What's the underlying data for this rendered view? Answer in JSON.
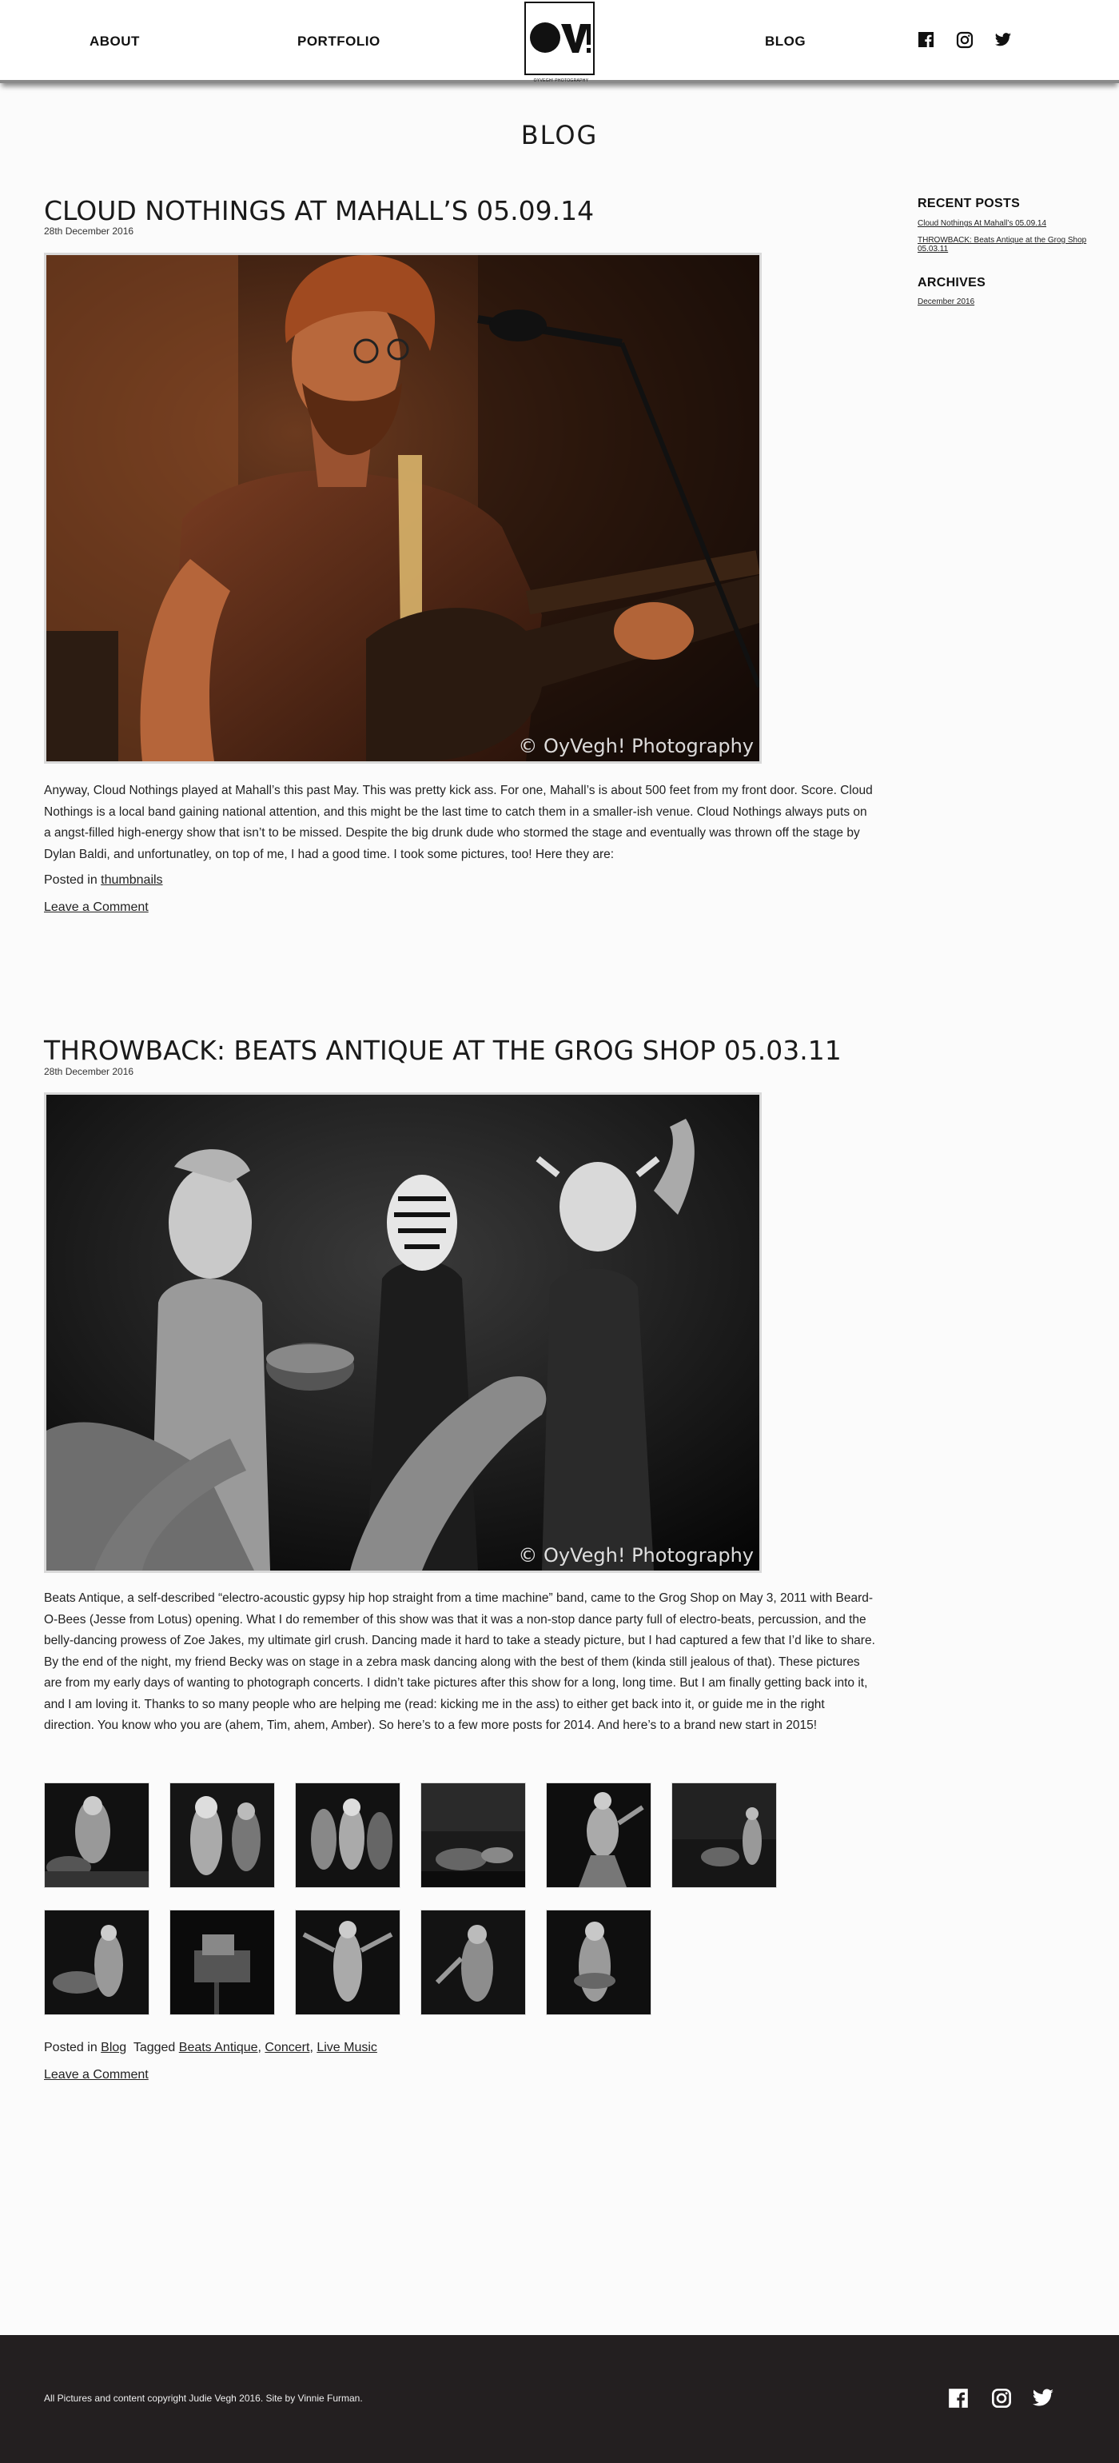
{
  "nav": {
    "about": "ABOUT",
    "portfolio": "PORTFOLIO",
    "blog": "BLOG",
    "logo_text": "OV!",
    "logo_subtext": "OYVEGH! PHOTOGRAPHY"
  },
  "icons": {
    "facebook": "facebook-icon",
    "instagram": "instagram-icon",
    "twitter": "twitter-icon"
  },
  "page_title": "BLOG",
  "posts": [
    {
      "title": "CLOUD NOTHINGS AT MAHALL’S 05.09.14",
      "date": "28th December 2016",
      "watermark": "© OyVegh! Photography",
      "body": "Anyway, Cloud Nothings played at Mahall’s this past May. This was pretty kick ass. For one, Mahall’s is about 500 feet from my front door. Score. Cloud Nothings is a local band gaining national attention, and this might be the last time to catch them in a smaller-ish venue. Cloud Nothings always puts on a angst-filled high-energy show that isn’t to be missed. Despite the big drunk dude who stormed the stage and eventually was thrown off the stage by Dylan Baldi, and unfortunatley, on top of me, I had a good time. I took some pictures, too! Here they are:",
      "posted_in_label": "Posted in",
      "category": "thumbnails",
      "comment": "Leave a Comment"
    },
    {
      "title": "THROWBACK: BEATS ANTIQUE AT THE GROG SHOP 05.03.11",
      "date": "28th December 2016",
      "watermark": "© OyVegh! Photography",
      "body": "Beats Antique, a self-described “electro-acoustic gypsy hip hop straight from a time machine” band, came to the Grog Shop on May 3, 2011 with Beard-O-Bees (Jesse from Lotus) opening. What I do remember of this show was that it was a non-stop dance party full of electro-beats, percussion, and the belly-dancing prowess of Zoe Jakes, my ultimate girl crush. Dancing made it hard to take a steady picture, but I had captured a few that I’d like to share. By the end of the night, my friend Becky was on stage in a zebra mask dancing along with the best of them (kinda still jealous of that). These pictures are from my early days of wanting to photograph concerts. I didn’t take pictures after this show for a long, long time. But I am finally getting back into it, and I am loving it. Thanks to so many people who are helping me (read: kicking me in the ass) to either get back into it, or guide me in the right direction. You know who you are (ahem, Tim, ahem, Amber). So here’s to a few more posts for 2014. And here’s to a brand new start in 2015!",
      "posted_in_label": "Posted in",
      "category": "Blog",
      "tagged_label": "Tagged",
      "tags": [
        "Beats Antique",
        "Concert",
        "Live Music"
      ],
      "comment": "Leave a Comment"
    }
  ],
  "sidebar": {
    "recent_heading": "RECENT POSTS",
    "recent_posts": [
      "Cloud Nothings At Mahall’s 05.09.14",
      "THROWBACK: Beats Antique at the Grog Shop 05.03.11"
    ],
    "archives_heading": "ARCHIVES",
    "archives": [
      "December 2016"
    ]
  },
  "footer": {
    "copyright": "All Pictures and content copyright Judie Vegh 2016. Site by Vinnie Furman."
  },
  "colors": {
    "background": "#fbfbfb",
    "footer": "#231f20",
    "text": "#1a1a1a"
  }
}
